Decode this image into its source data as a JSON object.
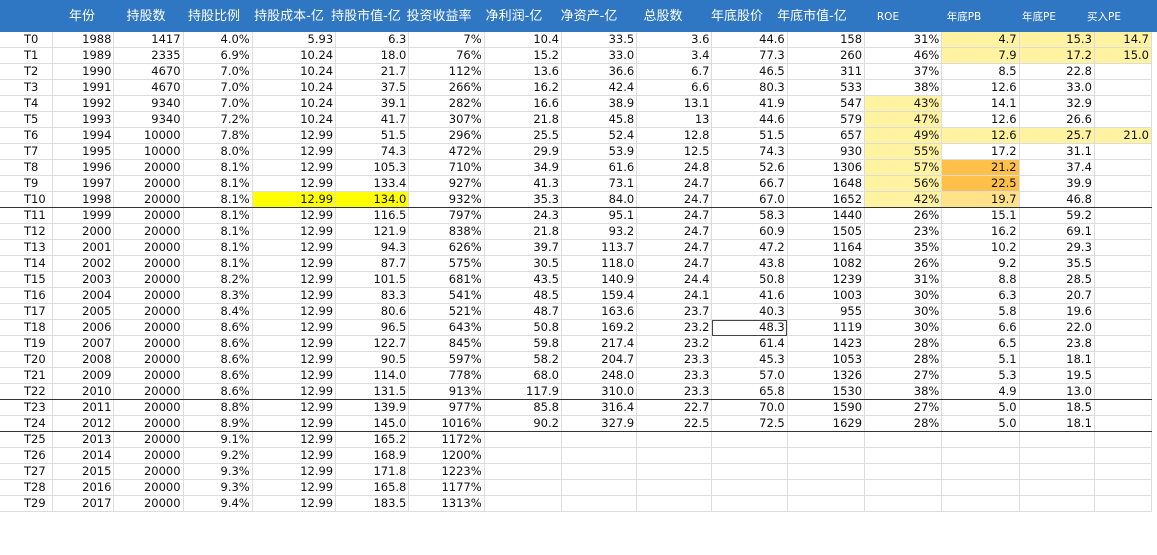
{
  "headers": [
    "",
    "年份",
    "持股数",
    "持股比例",
    "持股成本-亿",
    "持股市值-亿",
    "投资收益率",
    "净利润-亿",
    "净资产-亿",
    "总股数",
    "年底股价",
    "年底市值-亿",
    "ROE",
    "年底PB",
    "年底PE",
    "买入PE"
  ],
  "rows": [
    [
      "T0",
      "1988",
      "1417",
      "4.0%",
      "5.93",
      "6.3",
      "7%",
      "10.4",
      "33.5",
      "3.6",
      "44.6",
      "158",
      "31%",
      "4.7",
      "15.3",
      "14.7"
    ],
    [
      "T1",
      "1989",
      "2335",
      "6.9%",
      "10.24",
      "18.0",
      "76%",
      "15.2",
      "33.0",
      "3.4",
      "77.3",
      "260",
      "46%",
      "7.9",
      "17.2",
      "15.0"
    ],
    [
      "T2",
      "1990",
      "4670",
      "7.0%",
      "10.24",
      "21.7",
      "112%",
      "13.6",
      "36.6",
      "6.7",
      "46.5",
      "311",
      "37%",
      "8.5",
      "22.8",
      ""
    ],
    [
      "T3",
      "1991",
      "4670",
      "7.0%",
      "10.24",
      "37.5",
      "266%",
      "16.2",
      "42.4",
      "6.6",
      "80.3",
      "533",
      "38%",
      "12.6",
      "33.0",
      ""
    ],
    [
      "T4",
      "1992",
      "9340",
      "7.0%",
      "10.24",
      "39.1",
      "282%",
      "16.6",
      "38.9",
      "13.1",
      "41.9",
      "547",
      "43%",
      "14.1",
      "32.9",
      ""
    ],
    [
      "T5",
      "1993",
      "9340",
      "7.2%",
      "10.24",
      "41.7",
      "307%",
      "21.8",
      "45.8",
      "13",
      "44.6",
      "579",
      "47%",
      "12.6",
      "26.6",
      ""
    ],
    [
      "T6",
      "1994",
      "10000",
      "7.8%",
      "12.99",
      "51.5",
      "296%",
      "25.5",
      "52.4",
      "12.8",
      "51.5",
      "657",
      "49%",
      "12.6",
      "25.7",
      "21.0"
    ],
    [
      "T7",
      "1995",
      "10000",
      "8.0%",
      "12.99",
      "74.3",
      "472%",
      "29.9",
      "53.9",
      "12.5",
      "74.3",
      "930",
      "55%",
      "17.2",
      "31.1",
      ""
    ],
    [
      "T8",
      "1996",
      "20000",
      "8.1%",
      "12.99",
      "105.3",
      "710%",
      "34.9",
      "61.6",
      "24.8",
      "52.6",
      "1306",
      "57%",
      "21.2",
      "37.4",
      ""
    ],
    [
      "T9",
      "1997",
      "20000",
      "8.1%",
      "12.99",
      "133.4",
      "927%",
      "41.3",
      "73.1",
      "24.7",
      "66.7",
      "1648",
      "56%",
      "22.5",
      "39.9",
      ""
    ],
    [
      "T10",
      "1998",
      "20000",
      "8.1%",
      "12.99",
      "134.0",
      "932%",
      "35.3",
      "84.0",
      "24.7",
      "67.0",
      "1652",
      "42%",
      "19.7",
      "46.8",
      ""
    ],
    [
      "T11",
      "1999",
      "20000",
      "8.1%",
      "12.99",
      "116.5",
      "797%",
      "24.3",
      "95.1",
      "24.7",
      "58.3",
      "1440",
      "26%",
      "15.1",
      "59.2",
      ""
    ],
    [
      "T12",
      "2000",
      "20000",
      "8.1%",
      "12.99",
      "121.9",
      "838%",
      "21.8",
      "93.2",
      "24.7",
      "60.9",
      "1505",
      "23%",
      "16.2",
      "69.1",
      ""
    ],
    [
      "T13",
      "2001",
      "20000",
      "8.1%",
      "12.99",
      "94.3",
      "626%",
      "39.7",
      "113.7",
      "24.7",
      "47.2",
      "1164",
      "35%",
      "10.2",
      "29.3",
      ""
    ],
    [
      "T14",
      "2002",
      "20000",
      "8.1%",
      "12.99",
      "87.7",
      "575%",
      "30.5",
      "118.0",
      "24.7",
      "43.8",
      "1082",
      "26%",
      "9.2",
      "35.5",
      ""
    ],
    [
      "T15",
      "2003",
      "20000",
      "8.2%",
      "12.99",
      "101.5",
      "681%",
      "43.5",
      "140.9",
      "24.4",
      "50.8",
      "1239",
      "31%",
      "8.8",
      "28.5",
      ""
    ],
    [
      "T16",
      "2004",
      "20000",
      "8.3%",
      "12.99",
      "83.3",
      "541%",
      "48.5",
      "159.4",
      "24.1",
      "41.6",
      "1003",
      "30%",
      "6.3",
      "20.7",
      ""
    ],
    [
      "T17",
      "2005",
      "20000",
      "8.4%",
      "12.99",
      "80.6",
      "521%",
      "48.7",
      "163.6",
      "23.7",
      "40.3",
      "955",
      "30%",
      "5.8",
      "19.6",
      ""
    ],
    [
      "T18",
      "2006",
      "20000",
      "8.6%",
      "12.99",
      "96.5",
      "643%",
      "50.8",
      "169.2",
      "23.2",
      "48.3",
      "1119",
      "30%",
      "6.6",
      "22.0",
      ""
    ],
    [
      "T19",
      "2007",
      "20000",
      "8.6%",
      "12.99",
      "122.7",
      "845%",
      "59.8",
      "217.4",
      "23.2",
      "61.4",
      "1423",
      "28%",
      "6.5",
      "23.8",
      ""
    ],
    [
      "T20",
      "2008",
      "20000",
      "8.6%",
      "12.99",
      "90.5",
      "597%",
      "58.2",
      "204.7",
      "23.3",
      "45.3",
      "1053",
      "28%",
      "5.1",
      "18.1",
      ""
    ],
    [
      "T21",
      "2009",
      "20000",
      "8.6%",
      "12.99",
      "114.0",
      "778%",
      "68.0",
      "248.0",
      "23.3",
      "57.0",
      "1326",
      "27%",
      "5.3",
      "19.5",
      ""
    ],
    [
      "T22",
      "2010",
      "20000",
      "8.6%",
      "12.99",
      "131.5",
      "913%",
      "117.9",
      "310.0",
      "23.3",
      "65.8",
      "1530",
      "38%",
      "4.9",
      "13.0",
      ""
    ],
    [
      "T23",
      "2011",
      "20000",
      "8.8%",
      "12.99",
      "139.9",
      "977%",
      "85.8",
      "316.4",
      "22.7",
      "70.0",
      "1590",
      "27%",
      "5.0",
      "18.5",
      ""
    ],
    [
      "T24",
      "2012",
      "20000",
      "8.9%",
      "12.99",
      "145.0",
      "1016%",
      "90.2",
      "327.9",
      "22.5",
      "72.5",
      "1629",
      "28%",
      "5.0",
      "18.1",
      ""
    ],
    [
      "T25",
      "2013",
      "20000",
      "9.1%",
      "12.99",
      "165.2",
      "1172%",
      "",
      "",
      "",
      "",
      "",
      "",
      "",
      "",
      ""
    ],
    [
      "T26",
      "2014",
      "20000",
      "9.2%",
      "12.99",
      "168.9",
      "1200%",
      "",
      "",
      "",
      "",
      "",
      "",
      "",
      "",
      ""
    ],
    [
      "T27",
      "2015",
      "20000",
      "9.3%",
      "12.99",
      "171.8",
      "1223%",
      "",
      "",
      "",
      "",
      "",
      "",
      "",
      "",
      ""
    ],
    [
      "T28",
      "2016",
      "20000",
      "9.3%",
      "12.99",
      "165.8",
      "1177%",
      "",
      "",
      "",
      "",
      "",
      "",
      "",
      "",
      ""
    ],
    [
      "T29",
      "2017",
      "20000",
      "9.4%",
      "12.99",
      "183.5",
      "1313%",
      "",
      "",
      "",
      "",
      "",
      "",
      "",
      "",
      ""
    ]
  ],
  "colors": {
    "header_bg": "#2f76c3",
    "light_yellow": "#fff2a0",
    "yellow": "#ffe28a",
    "orange": "#ffc04a",
    "bright_yellow": "#ffff00"
  }
}
